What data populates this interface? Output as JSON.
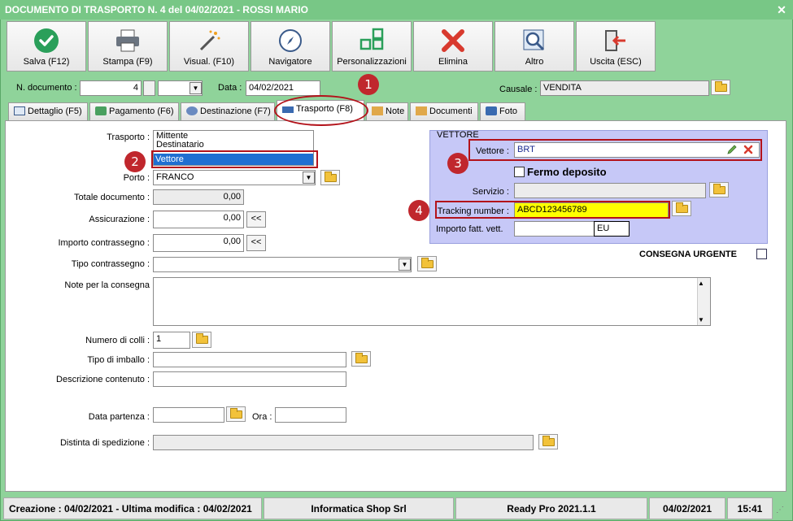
{
  "window": {
    "title": "DOCUMENTO DI TRASPORTO N. 4 del 04/02/2021 - ROSSI MARIO",
    "close": "✕"
  },
  "toolbar": {
    "buttons": [
      {
        "label": "Salva (F12)",
        "icon": "check-icon"
      },
      {
        "label": "Stampa (F9)",
        "icon": "printer-icon"
      },
      {
        "label": "Visual. (F10)",
        "icon": "magic-wand-icon"
      },
      {
        "label": "Navigatore",
        "icon": "compass-icon"
      },
      {
        "label": "Personalizzazioni",
        "icon": "grid-icon"
      },
      {
        "label": "Elimina",
        "icon": "delete-x-icon"
      },
      {
        "label": "Altro",
        "icon": "magnifier-icon"
      },
      {
        "label": "Uscita (ESC)",
        "icon": "exit-icon"
      }
    ]
  },
  "header": {
    "ndoc_label": "N. documento :",
    "ndoc_value": "4",
    "data_label": "Data :",
    "data_value": "04/02/2021",
    "causale_label": "Causale :",
    "causale_value": "VENDITA"
  },
  "tabs": [
    {
      "label": "Dettaglio (F5)"
    },
    {
      "label": "Pagamento (F6)"
    },
    {
      "label": "Destinazione (F7)"
    },
    {
      "label": "Trasporto (F8)"
    },
    {
      "label": "Note"
    },
    {
      "label": "Documenti"
    },
    {
      "label": "Foto"
    }
  ],
  "trasporto": {
    "trasporto_label": "Trasporto :",
    "options": [
      "Mittente",
      "Destinatario",
      "Vettore"
    ],
    "porto_label": "Porto :",
    "porto_value": "FRANCO",
    "totale_label": "Totale documento :",
    "totale_value": "0,00",
    "assicurazione_label": "Assicurazione :",
    "assicurazione_value": "0,00",
    "contrassegno_label": "Importo contrassegno :",
    "contrassegno_value": "0,00",
    "tipo_contrassegno_label": "Tipo contrassegno :",
    "note_label": "Note per la consegna",
    "colli_label": "Numero di colli :",
    "colli_value": "1",
    "imballo_label": "Tipo di imballo :",
    "descrizione_label": "Descrizione contenuto :",
    "data_partenza_label": "Data partenza :",
    "ora_label": "Ora :",
    "distinta_label": "Distinta di spedizione :",
    "shift_left": "<<"
  },
  "vettore": {
    "group_label": "VETTORE",
    "vettore_label": "Vettore :",
    "vettore_value": "BRT",
    "fermo_label": "Fermo deposito",
    "servizio_label": "Servizio :",
    "tracking_label": "Tracking number :",
    "tracking_value": "ABCD123456789",
    "importo_label": "Importo fatt. vett.",
    "currency": "EU",
    "urgente_label": "CONSEGNA URGENTE"
  },
  "badges": [
    "1",
    "2",
    "3",
    "4"
  ],
  "status": {
    "created": "Creazione : 04/02/2021 - Ultima modifica : 04/02/2021",
    "company": "Informatica Shop Srl",
    "product": "Ready Pro 2021.1.1",
    "date": "04/02/2021",
    "time": "15:41"
  },
  "colors": {
    "accent_green": "#8fd39a",
    "highlight_red": "#b3121a",
    "tracking_bg": "#ffff00",
    "selection": "#1f6fd1",
    "vettore_bg": "#c6c8f7"
  }
}
